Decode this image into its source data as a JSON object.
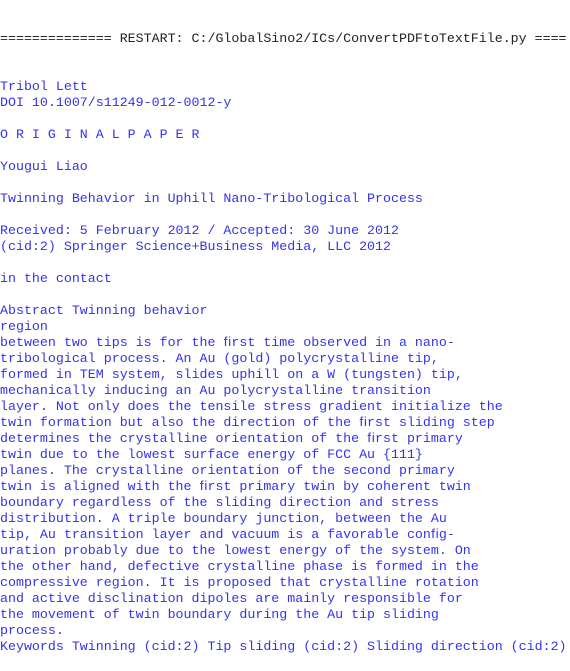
{
  "shell": {
    "restart_line": "============== RESTART: C:/GlobalSino2/ICs/ConvertPDFtoTextFile.py ====",
    "output_lines": [
      "Tribol Lett",
      "DOI 10.1007/s11249-012-0012-y",
      "",
      "O R I G I N A L P A P E R",
      "",
      "Yougui Liao",
      "",
      "Twinning Behavior in Uphill Nano-Tribological Process",
      "",
      "Received: 5 February 2012 / Accepted: 30 June 2012",
      "(cid:2) Springer Science+Business Media, LLC 2012",
      "",
      "in the contact",
      "",
      "Abstract Twinning behavior",
      "region",
      "between two tips is for the ﬁrst time observed in a nano-",
      "tribological process. An Au (gold) polycrystalline tip,",
      "formed in TEM system, slides uphill on a W (tungsten) tip,",
      "mechanically inducing an Au polycrystalline transition",
      "layer. Not only does the tensile stress gradient initialize the",
      "twin formation but also the direction of the ﬁrst sliding step",
      "determines the crystalline orientation of the ﬁrst primary",
      "twin due to the lowest surface energy of FCC Au {111}",
      "planes. The crystalline orientation of the second primary",
      "twin is aligned with the ﬁrst primary twin by coherent twin",
      "boundary regardless of the sliding direction and stress",
      "distribution. A triple boundary junction, between the Au",
      "tip, Au transition layer and vacuum is a favorable conﬁg-",
      "uration probably due to the lowest energy of the system. On",
      "the other hand, defective crystalline phase is formed in the",
      "compressive region. It is proposed that crystalline rotation",
      "and active disclination dipoles are mainly responsible for",
      "the movement of twin boundary during the Au tip sliding",
      "process.",
      "Keywords Twinning (cid:2) Tip sliding (cid:2) Sliding direction (cid:2)"
    ]
  }
}
